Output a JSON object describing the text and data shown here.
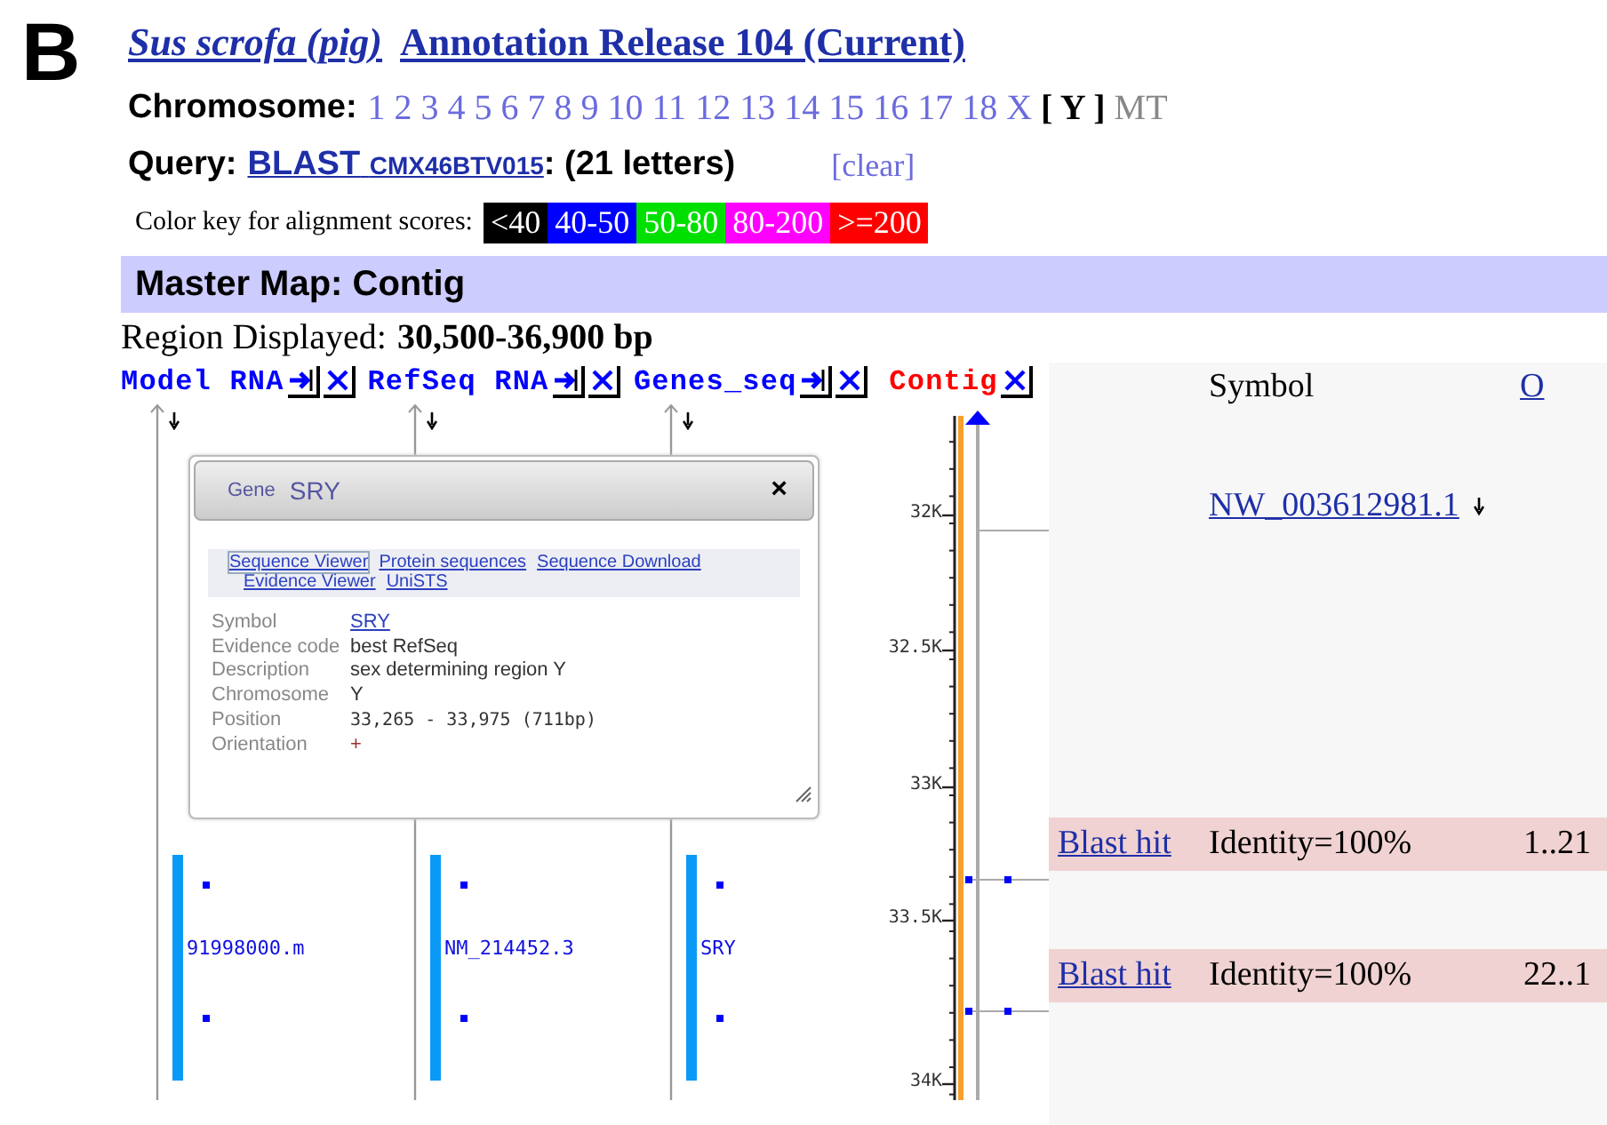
{
  "panel_label": "B",
  "header": {
    "organism": "Sus scrofa (pig)",
    "release": "Annotation Release 104 (Current)"
  },
  "chromosome": {
    "label": "Chromosome:",
    "items": [
      {
        "label": "1",
        "selected": false,
        "disabled": false
      },
      {
        "label": "2",
        "selected": false,
        "disabled": false
      },
      {
        "label": "3",
        "selected": false,
        "disabled": false
      },
      {
        "label": "4",
        "selected": false,
        "disabled": false
      },
      {
        "label": "5",
        "selected": false,
        "disabled": false
      },
      {
        "label": "6",
        "selected": false,
        "disabled": false
      },
      {
        "label": "7",
        "selected": false,
        "disabled": false
      },
      {
        "label": "8",
        "selected": false,
        "disabled": false
      },
      {
        "label": "9",
        "selected": false,
        "disabled": false
      },
      {
        "label": "10",
        "selected": false,
        "disabled": false
      },
      {
        "label": "11",
        "selected": false,
        "disabled": false
      },
      {
        "label": "12",
        "selected": false,
        "disabled": false
      },
      {
        "label": "13",
        "selected": false,
        "disabled": false
      },
      {
        "label": "14",
        "selected": false,
        "disabled": false
      },
      {
        "label": "15",
        "selected": false,
        "disabled": false
      },
      {
        "label": "16",
        "selected": false,
        "disabled": false
      },
      {
        "label": "17",
        "selected": false,
        "disabled": false
      },
      {
        "label": "18",
        "selected": false,
        "disabled": false
      },
      {
        "label": "X",
        "selected": false,
        "disabled": false
      },
      {
        "label": "[ Y ]",
        "selected": true,
        "disabled": false
      },
      {
        "label": "MT",
        "selected": false,
        "disabled": true
      }
    ]
  },
  "query": {
    "label": "Query:",
    "link": "BLAST",
    "id": "CMX46BTV015",
    "suffix": ": (21 letters)",
    "clear": "[clear]"
  },
  "color_key": {
    "label": "Color key for alignment scores:",
    "items": [
      {
        "label": "<40",
        "color": "#000000"
      },
      {
        "label": "40-50",
        "color": "#0000ff"
      },
      {
        "label": "50-80",
        "color": "#00e000"
      },
      {
        "label": "80-200",
        "color": "#ff00ff"
      },
      {
        "label": ">=200",
        "color": "#ff0000"
      }
    ]
  },
  "map": {
    "title": "Master Map: Contig",
    "region_label": "Region Displayed:",
    "region_value": "30,500-36,900 bp",
    "tracks": [
      {
        "name": "Model RNA",
        "color": "#0000ff",
        "feature": "91998000.m"
      },
      {
        "name": "RefSeq RNA",
        "color": "#0000ff",
        "feature": "NM_214452.3"
      },
      {
        "name": "Genes_seq",
        "color": "#0000ff",
        "feature": "SRY"
      }
    ],
    "contig": {
      "name": "Contig",
      "color": "#ff0000"
    },
    "ruler": [
      "32K",
      "32.5K",
      "33K",
      "33.5K",
      "34K"
    ],
    "symbol_header": "Symbol",
    "o_link": "O",
    "accession": "NW_003612981.1",
    "hits": [
      {
        "link": "Blast hit",
        "identity": "Identity=100%",
        "range": "1..21"
      },
      {
        "link": "Blast hit",
        "identity": "Identity=100%",
        "range": "22..1"
      }
    ]
  },
  "popup": {
    "gene_label": "Gene",
    "gene": "SRY",
    "close": "×",
    "links": [
      "Sequence Viewer",
      "Protein sequences",
      "Sequence Download",
      "Evidence Viewer",
      "UniSTS"
    ],
    "fields": [
      {
        "label": "Symbol",
        "value": "SRY",
        "kind": "link"
      },
      {
        "label": "Evidence code",
        "value": "best RefSeq",
        "kind": "text"
      },
      {
        "label": "Description",
        "value": "sex determining region Y",
        "kind": "text"
      },
      {
        "label": "Chromosome",
        "value": "Y",
        "kind": "text"
      },
      {
        "label": "Position",
        "value": "33,265 - 33,975 (711bp)",
        "kind": "mono"
      },
      {
        "label": "Orientation",
        "value": "+",
        "kind": "sign"
      }
    ]
  }
}
